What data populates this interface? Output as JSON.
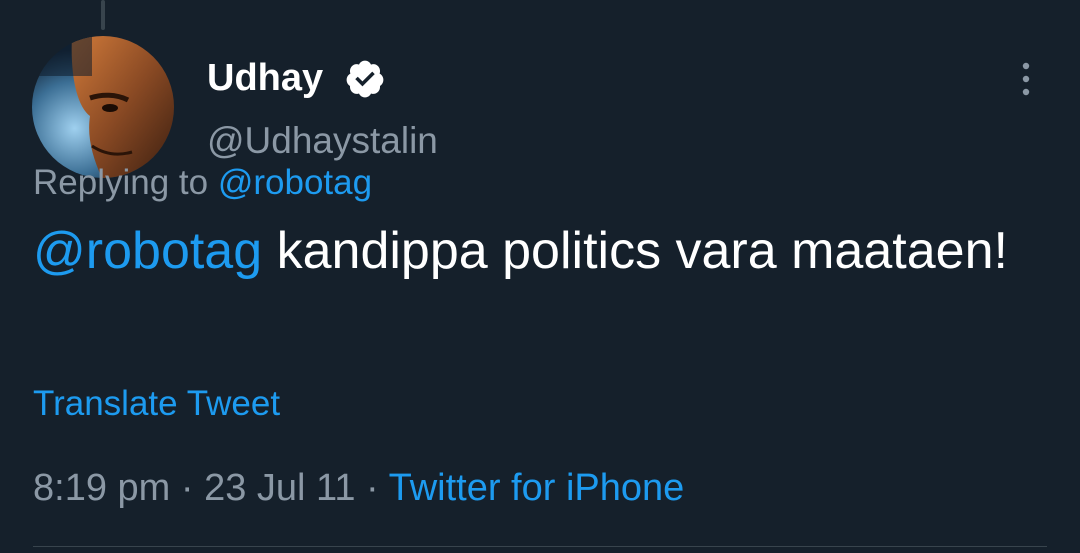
{
  "tweet": {
    "author": {
      "name": "Udhay",
      "handle": "@Udhaystalin",
      "verified": true
    },
    "replying": {
      "prefix": "Replying to ",
      "mention": "@robotag"
    },
    "text": {
      "mention": "@robotag",
      "body": " kandippa politics vara maataen!"
    },
    "translate_label": "Translate Tweet",
    "meta": {
      "time": "8:19 pm",
      "sep1": " · ",
      "date": "23 Jul 11",
      "sep2": " · ",
      "source": "Twitter for iPhone"
    }
  },
  "icons": {
    "verified": "verified-badge-icon",
    "more": "more-vertical-icon"
  },
  "colors": {
    "background": "#15202b",
    "link": "#1d9bf0",
    "secondary_text": "#8b98a5",
    "primary_text": "#ffffff"
  }
}
